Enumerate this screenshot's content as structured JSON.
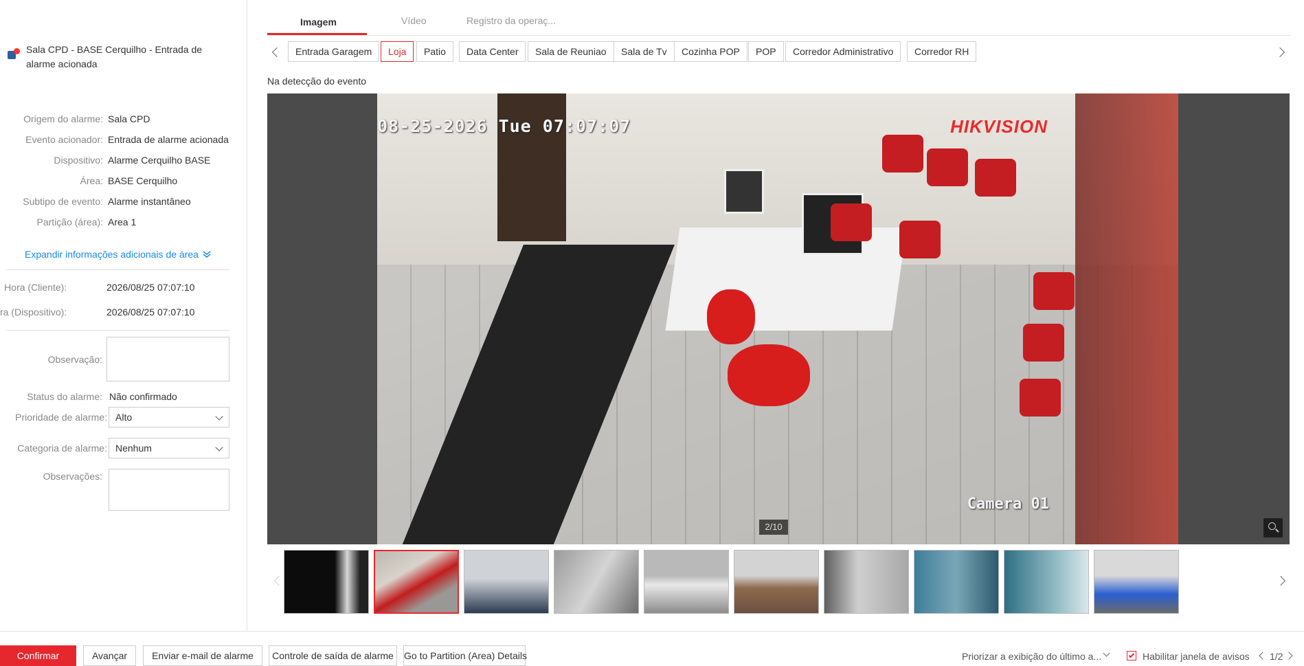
{
  "alarm": {
    "title": "Sala CPD - BASE Cerquilho - Entrada de alarme acionada"
  },
  "details": [
    {
      "label": "Origem do alarme:",
      "value": "Sala CPD"
    },
    {
      "label": "Evento acionador:",
      "value": "Entrada de alarme acionada"
    },
    {
      "label": "Dispositivo:",
      "value": "Alarme Cerquilho BASE"
    },
    {
      "label": "Área:",
      "value": "BASE Cerquilho"
    },
    {
      "label": "Subtipo de evento:",
      "value": "Alarme instantâneo"
    },
    {
      "label": "Partição (área):",
      "value": "Area 1"
    }
  ],
  "expand_label": "Expandir informações adicionais de área",
  "times": [
    {
      "label": "Hora (Cliente):",
      "value": "2026/08/25 07:07:10"
    },
    {
      "label": "Hora (Dispositivo):",
      "value": "2026/08/25 07:07:10"
    }
  ],
  "form": {
    "observacao_label": "Observação:",
    "status_label": "Status do alarme:",
    "status_value": "Não confirmado",
    "priority_label": "Prioridade de alarme:",
    "priority_value": "Alto",
    "category_label": "Categoria de alarme:",
    "category_value": "Nenhum",
    "observacoes_label": "Observações:"
  },
  "tabs": [
    {
      "label": "Imagem",
      "active": true
    },
    {
      "label": "Vídeo",
      "active": false
    },
    {
      "label": "Registro da operaç...",
      "active": false
    }
  ],
  "cameras": [
    {
      "label": "Entrada Garagem"
    },
    {
      "label": "Loja"
    },
    {
      "label": "Patio"
    },
    {
      "label": "Data Center"
    },
    {
      "label": "Sala de Reuniao"
    },
    {
      "label": "Sala de Tv"
    },
    {
      "label": "Cozinha POP"
    },
    {
      "label": "POP"
    },
    {
      "label": "Corredor Administrativo"
    },
    {
      "label": "Corredor RH"
    }
  ],
  "active_camera": "Loja",
  "detection_label": "Na detecção do evento",
  "viewer": {
    "osd_time": "08-25-2026 Tue 07:07:07",
    "osd_brand": "HIKVISION",
    "osd_camera": "Camera 01",
    "counter": "2/10"
  },
  "thumbnails_active_index": 1,
  "footer": {
    "confirm": "Confirmar",
    "advance": "Avançar",
    "email": "Enviar e-mail de alarme",
    "output": "Controle de saída de alarme",
    "partition": "Go to Partition (Area) Details",
    "priority_display": "Priorizar a exibição do último a...",
    "enable_popup": "Habilitar janela de avisos",
    "pager": "1/2"
  },
  "colors": {
    "accent": "#e5282e",
    "link": "#1a88e8"
  }
}
